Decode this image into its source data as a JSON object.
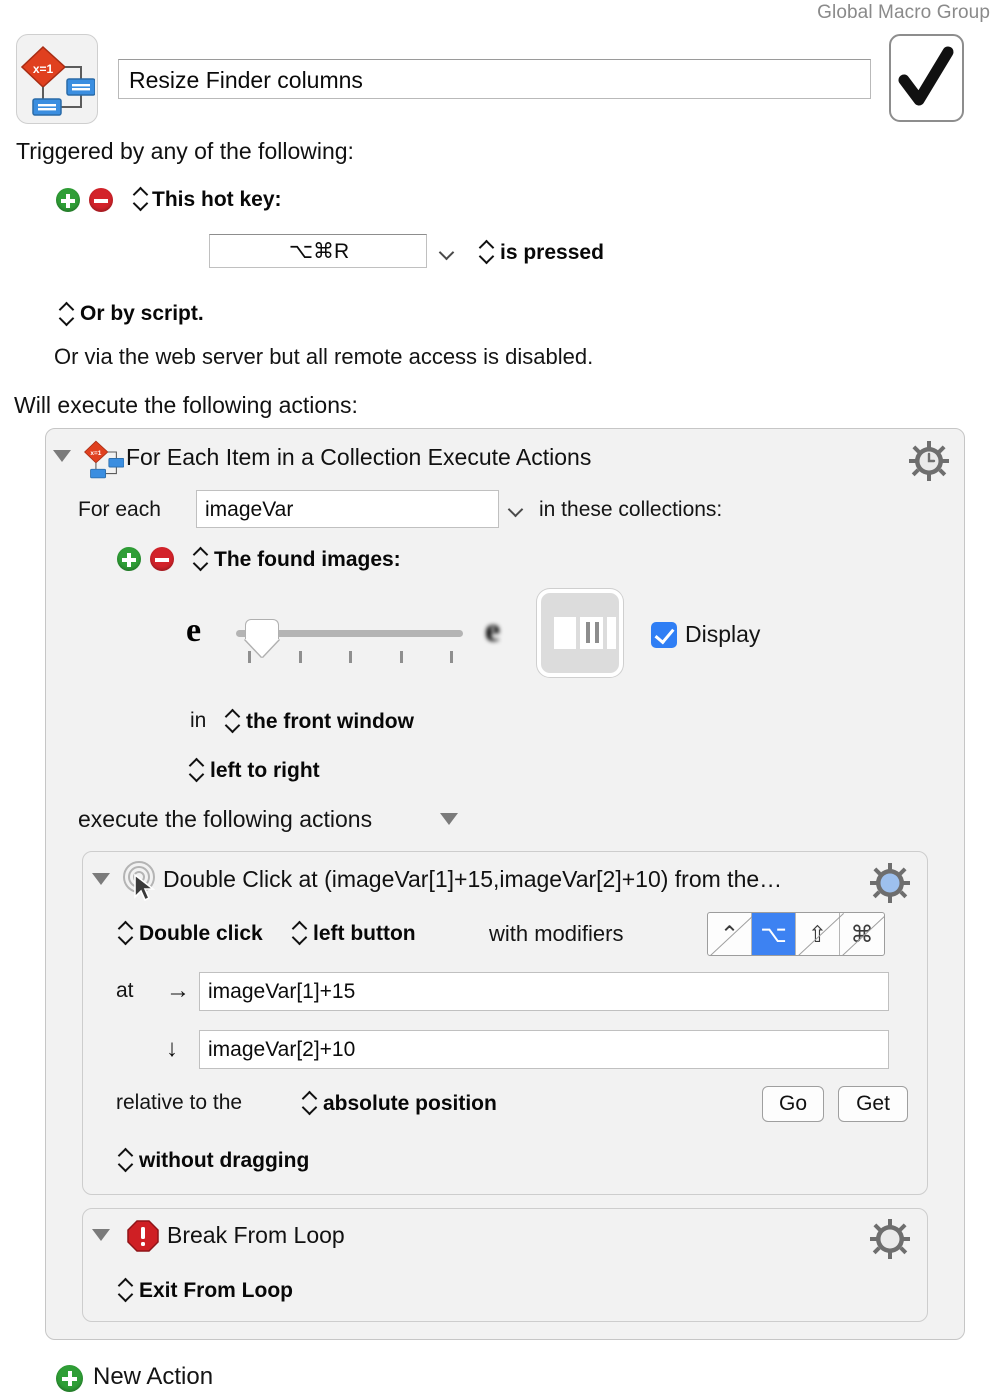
{
  "header": {
    "group_label": "Global Macro Group",
    "macro_name": "Resize Finder columns",
    "macro_icon_name": "flowchart-macro-icon",
    "macro_icon_text": "x=1",
    "enabled_checkmark": "enabled"
  },
  "triggers": {
    "heading": "Triggered by any of the following:",
    "hotkey_label": "This hot key:",
    "hotkey_value": "⌥⌘R",
    "hotkey_condition": "is pressed",
    "script_trigger": "Or by script.",
    "webserver_note": "Or via the web server but all remote access is disabled."
  },
  "actions_heading": "Will execute the following actions:",
  "loop_action": {
    "title": "For Each Item in a Collection Execute Actions",
    "for_each_label": "For each",
    "variable_value": "imageVar",
    "in_collections_label": "in these collections:",
    "collection_label": "The found images:",
    "fuzz_left_glyph": "e",
    "fuzz_right_glyph": "e",
    "display_label": "Display",
    "display_checked": true,
    "in_label": "in",
    "window_scope": "the front window",
    "scan_order": "left to right",
    "execute_label": "execute the following actions"
  },
  "click_action": {
    "title": "Double Click at (imageVar[1]+15,imageVar[2]+10) from the…",
    "click_type": "Double click",
    "button": "left button",
    "modifiers_label": "with modifiers",
    "modifiers": [
      {
        "name": "control",
        "glyph": "⌃",
        "selected": false
      },
      {
        "name": "option",
        "glyph": "⌥",
        "selected": true
      },
      {
        "name": "shift",
        "glyph": "⇧",
        "selected": false
      },
      {
        "name": "command",
        "glyph": "⌘",
        "selected": false
      }
    ],
    "at_label": "at",
    "x_arrow": "→",
    "x_value": "imageVar[1]+15",
    "y_arrow": "↓",
    "y_value": "imageVar[2]+10",
    "relative_label": "relative to the",
    "relative_value": "absolute position",
    "go_button": "Go",
    "get_button": "Get",
    "drag_option": "without dragging"
  },
  "break_action": {
    "title": "Break From Loop",
    "exit_option": "Exit From Loop"
  },
  "footer": {
    "new_action": "New Action"
  },
  "colors": {
    "accent_blue": "#3d82f2",
    "add_green": "#2f9e36",
    "remove_red": "#d3232a",
    "stop_red": "#cf1f24",
    "panel_bg": "#f2f2f2",
    "group_label_gray": "#8a8a8a"
  }
}
